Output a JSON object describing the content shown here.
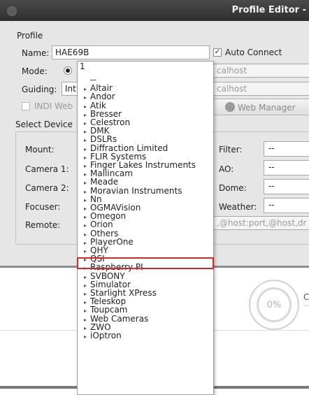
{
  "window": {
    "title": "Profile Editor -"
  },
  "profile": {
    "section_label": "Profile",
    "name_label": "Name:",
    "name_value": "HAE69B",
    "auto_connect_label": "Auto Connect",
    "mode_label": "Mode:",
    "host_placeholder_1": "calhost",
    "host_placeholder_2": "calhost",
    "guiding_label": "Guiding:",
    "guiding_value": "Int",
    "indi_web_label": "INDI Web",
    "web_manager_label": "Web Manager"
  },
  "devices": {
    "section_label": "Select Device",
    "mount_label": "Mount:",
    "camera1_label": "Camera 1:",
    "camera2_label": "Camera 2:",
    "focuser_label": "Focuser:",
    "remote_label": "Remote:",
    "filter_label": "Filter:",
    "ao_label": "AO:",
    "dome_label": "Dome:",
    "weather_label": "Weather:",
    "filter_value": "--",
    "ao_value": "--",
    "dome_value": "--",
    "weather_value": "--",
    "remote_placeholder": ",@host:port,@host,dr"
  },
  "progress": {
    "value_text": "0%",
    "side_char": "C",
    "side_dots": "--"
  },
  "dropdown": {
    "typed_value": "1",
    "items": [
      {
        "label": "--",
        "expandable": false
      },
      {
        "label": "Altair",
        "expandable": true
      },
      {
        "label": "Andor",
        "expandable": true
      },
      {
        "label": "Atik",
        "expandable": true
      },
      {
        "label": "Bresser",
        "expandable": true
      },
      {
        "label": "Celestron",
        "expandable": true
      },
      {
        "label": "DMK",
        "expandable": true
      },
      {
        "label": "DSLRs",
        "expandable": true
      },
      {
        "label": "Diffraction Limited",
        "expandable": true
      },
      {
        "label": "FLIR Systems",
        "expandable": true
      },
      {
        "label": "Finger Lakes Instruments",
        "expandable": true
      },
      {
        "label": "Mallincam",
        "expandable": true
      },
      {
        "label": "Meade",
        "expandable": true
      },
      {
        "label": "Moravian Instruments",
        "expandable": true
      },
      {
        "label": "Nn",
        "expandable": true
      },
      {
        "label": "OGMAVision",
        "expandable": true
      },
      {
        "label": "Omegon",
        "expandable": true
      },
      {
        "label": "Orion",
        "expandable": true
      },
      {
        "label": "Others",
        "expandable": true
      },
      {
        "label": "PlayerOne",
        "expandable": true,
        "highlighted": true
      },
      {
        "label": "QHY",
        "expandable": true
      },
      {
        "label": "QSI",
        "expandable": true
      },
      {
        "label": "Raspberry PI",
        "expandable": true
      },
      {
        "label": "SVBONY",
        "expandable": true
      },
      {
        "label": "Simulator",
        "expandable": true
      },
      {
        "label": "Starlight XPress",
        "expandable": true
      },
      {
        "label": "Teleskop",
        "expandable": true
      },
      {
        "label": "Toupcam",
        "expandable": true
      },
      {
        "label": "Web Cameras",
        "expandable": true
      },
      {
        "label": "ZWO",
        "expandable": true
      },
      {
        "label": "iOptron",
        "expandable": true
      }
    ]
  }
}
